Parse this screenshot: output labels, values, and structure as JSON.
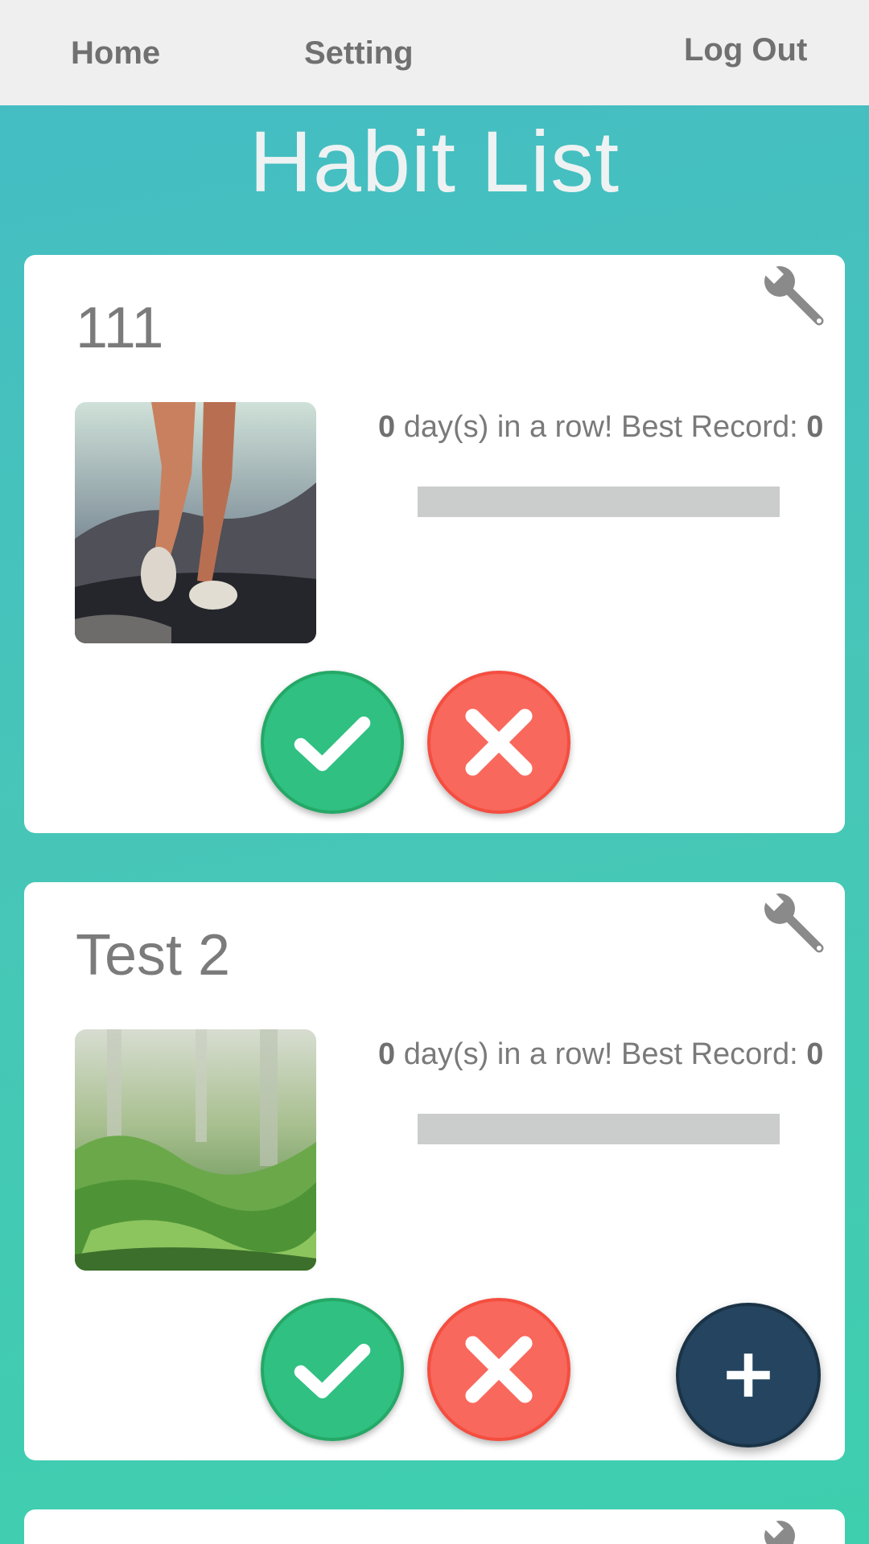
{
  "nav": {
    "home": "Home",
    "setting": "Setting",
    "logout": "Log Out"
  },
  "page_title": "Habit List",
  "habits": [
    {
      "name": "111",
      "current_streak": "0",
      "streak_text": " day(s) in a row! Best Record: ",
      "best_record": "0",
      "progress": 0,
      "image": "running-legs-photo",
      "icons": {
        "edit": "wrench-icon",
        "done": "check-icon",
        "fail": "close-icon"
      }
    },
    {
      "name": "Test 2",
      "current_streak": "0",
      "streak_text": " day(s) in a row! Best Record: ",
      "best_record": "0",
      "progress": 0,
      "image": "green-forest-photo",
      "icons": {
        "edit": "wrench-icon",
        "done": "check-icon",
        "fail": "close-icon"
      }
    }
  ],
  "fab": {
    "icon": "plus-icon"
  },
  "colors": {
    "topbar": "#efefef",
    "background_teal": "#44bcc4",
    "check_green": "#2fc082",
    "cross_red": "#f8685c",
    "fab_navy": "#24445f",
    "progress_track": "#cbcccc"
  }
}
